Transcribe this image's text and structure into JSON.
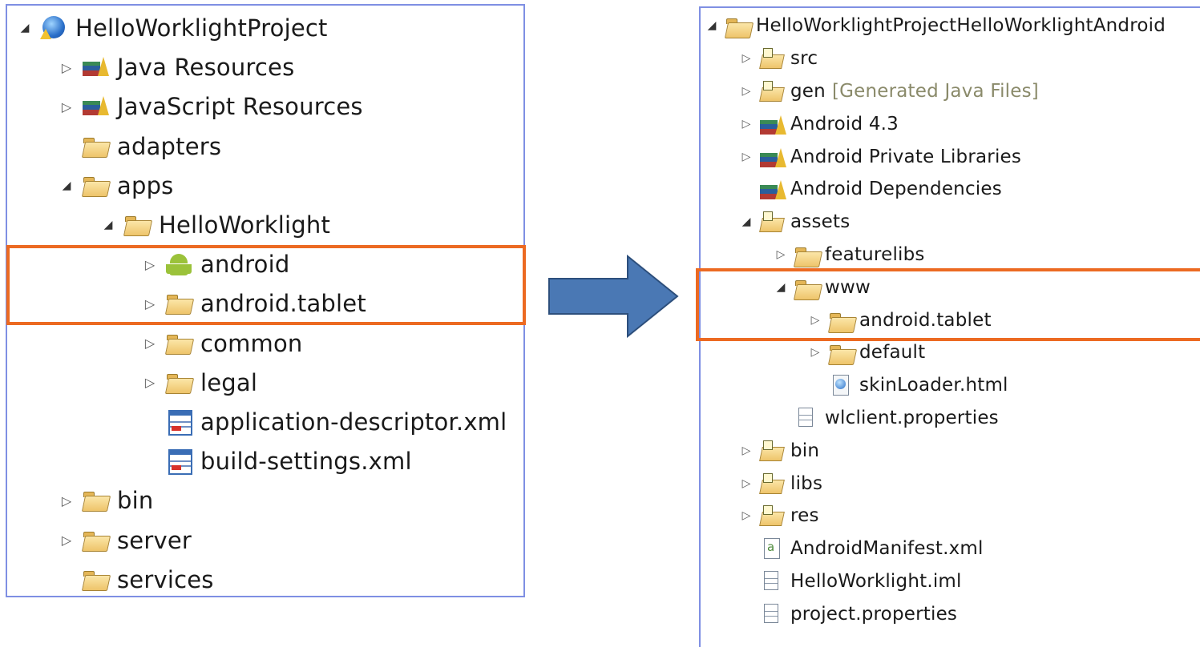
{
  "left_tree": {
    "rows": [
      {
        "label": "HelloWorklightProject",
        "depth": 0,
        "twisty": "expanded",
        "icon": "globe-project-icon"
      },
      {
        "label": "Java Resources",
        "depth": 1,
        "twisty": "collapsed",
        "icon": "library-icon"
      },
      {
        "label": "JavaScript Resources",
        "depth": 1,
        "twisty": "collapsed",
        "icon": "library-icon"
      },
      {
        "label": "adapters",
        "depth": 1,
        "twisty": "none",
        "icon": "folder-icon"
      },
      {
        "label": "apps",
        "depth": 1,
        "twisty": "expanded",
        "icon": "warning-folder-icon"
      },
      {
        "label": "HelloWorklight",
        "depth": 2,
        "twisty": "expanded",
        "icon": "warning-folder-icon"
      },
      {
        "label": "android",
        "depth": 3,
        "twisty": "collapsed",
        "icon": "android-icon"
      },
      {
        "label": "android.tablet",
        "depth": 3,
        "twisty": "collapsed",
        "icon": "folder-icon"
      },
      {
        "label": "common",
        "depth": 3,
        "twisty": "collapsed",
        "icon": "folder-icon"
      },
      {
        "label": "legal",
        "depth": 3,
        "twisty": "collapsed",
        "icon": "folder-icon"
      },
      {
        "label": "application-descriptor.xml",
        "depth": 3,
        "twisty": "none",
        "icon": "xml-file-icon"
      },
      {
        "label": "build-settings.xml",
        "depth": 3,
        "twisty": "none",
        "icon": "xml-file-icon"
      },
      {
        "label": "bin",
        "depth": 1,
        "twisty": "collapsed",
        "icon": "folder-icon"
      },
      {
        "label": "server",
        "depth": 1,
        "twisty": "collapsed",
        "icon": "folder-icon"
      },
      {
        "label": "services",
        "depth": 1,
        "twisty": "none",
        "icon": "folder-icon"
      }
    ]
  },
  "right_tree": {
    "rows": [
      {
        "label": "HelloWorklightProjectHelloWorklightAndroid",
        "depth": 0,
        "twisty": "expanded",
        "icon": "android-project-icon"
      },
      {
        "label": "src",
        "depth": 1,
        "twisty": "collapsed",
        "icon": "source-folder-icon"
      },
      {
        "label": "gen",
        "suffix": "[Generated Java Files]",
        "depth": 1,
        "twisty": "collapsed",
        "icon": "source-folder-icon"
      },
      {
        "label": "Android 4.3",
        "depth": 1,
        "twisty": "collapsed",
        "icon": "library-icon"
      },
      {
        "label": "Android Private Libraries",
        "depth": 1,
        "twisty": "collapsed",
        "icon": "library-icon"
      },
      {
        "label": "Android Dependencies",
        "depth": 1,
        "twisty": "none",
        "icon": "library-icon"
      },
      {
        "label": "assets",
        "depth": 1,
        "twisty": "expanded",
        "icon": "package-folder-icon"
      },
      {
        "label": "featurelibs",
        "depth": 2,
        "twisty": "collapsed",
        "icon": "folder-icon"
      },
      {
        "label": "www",
        "depth": 2,
        "twisty": "expanded",
        "icon": "folder-icon"
      },
      {
        "label": "android.tablet",
        "depth": 3,
        "twisty": "collapsed",
        "icon": "folder-icon"
      },
      {
        "label": "default",
        "depth": 3,
        "twisty": "collapsed",
        "icon": "folder-icon"
      },
      {
        "label": "skinLoader.html",
        "depth": 3,
        "twisty": "none",
        "icon": "html-file-icon"
      },
      {
        "label": "wlclient.properties",
        "depth": 2,
        "twisty": "none",
        "icon": "text-file-icon"
      },
      {
        "label": "bin",
        "depth": 1,
        "twisty": "collapsed",
        "icon": "package-folder-icon"
      },
      {
        "label": "libs",
        "depth": 1,
        "twisty": "collapsed",
        "icon": "package-folder-icon"
      },
      {
        "label": "res",
        "depth": 1,
        "twisty": "collapsed",
        "icon": "package-folder-icon"
      },
      {
        "label": "AndroidManifest.xml",
        "depth": 1,
        "twisty": "none",
        "icon": "manifest-file-icon"
      },
      {
        "label": "HelloWorklight.iml",
        "depth": 1,
        "twisty": "none",
        "icon": "text-file-icon"
      },
      {
        "label": "project.properties",
        "depth": 1,
        "twisty": "none",
        "icon": "text-file-icon"
      }
    ]
  },
  "colors": {
    "panel_border": "#7f8fe3",
    "highlight": "#ec6a22",
    "arrow_fill": "#4a78b4",
    "arrow_stroke": "#2d4f7c",
    "generated_text": "#8a8a6a"
  }
}
